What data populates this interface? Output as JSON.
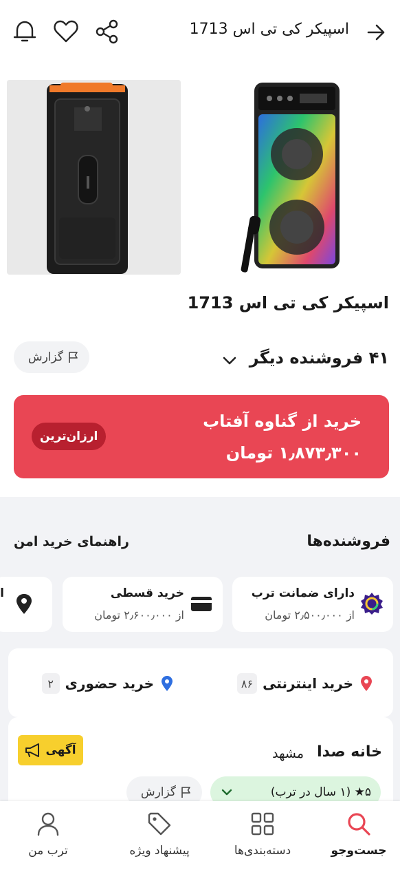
{
  "header": {
    "title": "اسپیکر کی تی اس 1713",
    "back_icon": "arrow-right-icon",
    "share_icon": "share-icon",
    "favorite_icon": "heart-icon",
    "notify_icon": "bell-icon"
  },
  "product": {
    "title": "اسپیکر کی تی اس 1713"
  },
  "sellers_summary": {
    "count_label": "۴۱ فروشنده دیگر",
    "report_label": "گزارش"
  },
  "best_offer": {
    "line1": "خرید از گناوه آفتاب",
    "line2": "۱٫۸۷۳٫۳۰۰ تومان",
    "badge": "ارزان‌ترین",
    "color": "#e94654"
  },
  "sellers_section": {
    "title": "فروشنده‌ها",
    "guide_link": "راهنمای خرید امن"
  },
  "chips": [
    {
      "title": "دارای ضمانت ترب",
      "sub": "از ۲٫۵۰۰٫۰۰۰ تومان",
      "icon": "torob-guarantee-icon"
    },
    {
      "title": "خرید قسطی",
      "sub": "از ۲٫۶۰۰٫۰۰۰ تومان",
      "icon": "credit-card-icon"
    },
    {
      "title": "ا",
      "sub": "",
      "icon": "location-pin-icon"
    }
  ],
  "purchase_modes": {
    "online_label": "خرید اینترنتی",
    "online_count": "۸۶",
    "inperson_label": "خرید حضوری",
    "inperson_count": "۲"
  },
  "shop": {
    "name": "خانه صدا",
    "city": "مشهد",
    "ad_label": "آگهی",
    "rating_text": "۵★ (۱ سال در ترب)",
    "report_label": "گزارش"
  },
  "bottom_nav": [
    {
      "label": "جست‌وجو",
      "icon": "search-icon",
      "active": true
    },
    {
      "label": "دسته‌بندی‌ها",
      "icon": "grid-icon"
    },
    {
      "label": "پیشنهاد ویژه",
      "icon": "tag-icon"
    },
    {
      "label": "ترب من",
      "icon": "user-icon"
    }
  ]
}
